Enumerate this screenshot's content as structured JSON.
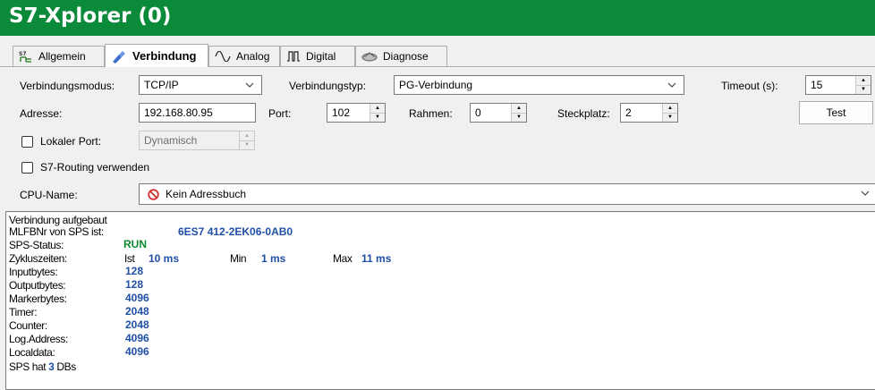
{
  "window": {
    "title": "S7-Xplorer (0)"
  },
  "tabs": [
    {
      "label": "Allgemein",
      "icon": "s7-network-icon"
    },
    {
      "label": "Verbindung",
      "icon": "plug-connection-icon",
      "active": true
    },
    {
      "label": "Analog",
      "icon": "sine-wave-icon"
    },
    {
      "label": "Digital",
      "icon": "square-wave-icon"
    },
    {
      "label": "Diagnose",
      "icon": "stethoscope-icon"
    }
  ],
  "form": {
    "mode_label": "Verbindungsmodus:",
    "mode_value": "TCP/IP",
    "type_label": "Verbindungstyp:",
    "type_value": "PG-Verbindung",
    "timeout_label": "Timeout (s):",
    "timeout_value": "15",
    "address_label": "Adresse:",
    "address_value": "192.168.80.95",
    "port_label": "Port:",
    "port_value": "102",
    "rack_label": "Rahmen:",
    "rack_value": "0",
    "slot_label": "Steckplatz:",
    "slot_value": "2",
    "test_button": "Test",
    "local_port_label": "Lokaler Port:",
    "local_port_value": "Dynamisch",
    "routing_label": "S7-Routing verwenden",
    "cpu_label": "CPU-Name:",
    "cpu_value": "Kein Adressbuch"
  },
  "status": {
    "connected": "Verbindung aufgebaut",
    "mlfb_label": "MLFBNr von SPS ist:",
    "mlfb_value": "6ES7 412-2EK06-0AB0",
    "sps_status_label": "SPS-Status:",
    "sps_status_value": "RUN",
    "cycle_label": "Zykluszeiten:",
    "cycle_ist_label": "Ist",
    "cycle_ist_value": "10 ms",
    "cycle_min_label": "Min",
    "cycle_min_value": "1 ms",
    "cycle_max_label": "Max",
    "cycle_max_value": "11 ms",
    "rows": [
      {
        "label": "Inputbytes:",
        "value": "128"
      },
      {
        "label": "Outputbytes:",
        "value": "128"
      },
      {
        "label": "Markerbytes:",
        "value": "4096"
      },
      {
        "label": "Timer:",
        "value": "2048"
      },
      {
        "label": "Counter:",
        "value": "2048"
      },
      {
        "label": "Log.Address:",
        "value": "4096"
      },
      {
        "label": "Localdata:",
        "value": "4096"
      }
    ],
    "db_prefix": "SPS hat",
    "db_count": "3",
    "db_suffix": "DBs"
  },
  "colors": {
    "titlebar": "#0b8a3a",
    "value_blue": "#1f4fa6",
    "run_green": "#0b8a2f",
    "no_entry_red": "#d0312d"
  }
}
